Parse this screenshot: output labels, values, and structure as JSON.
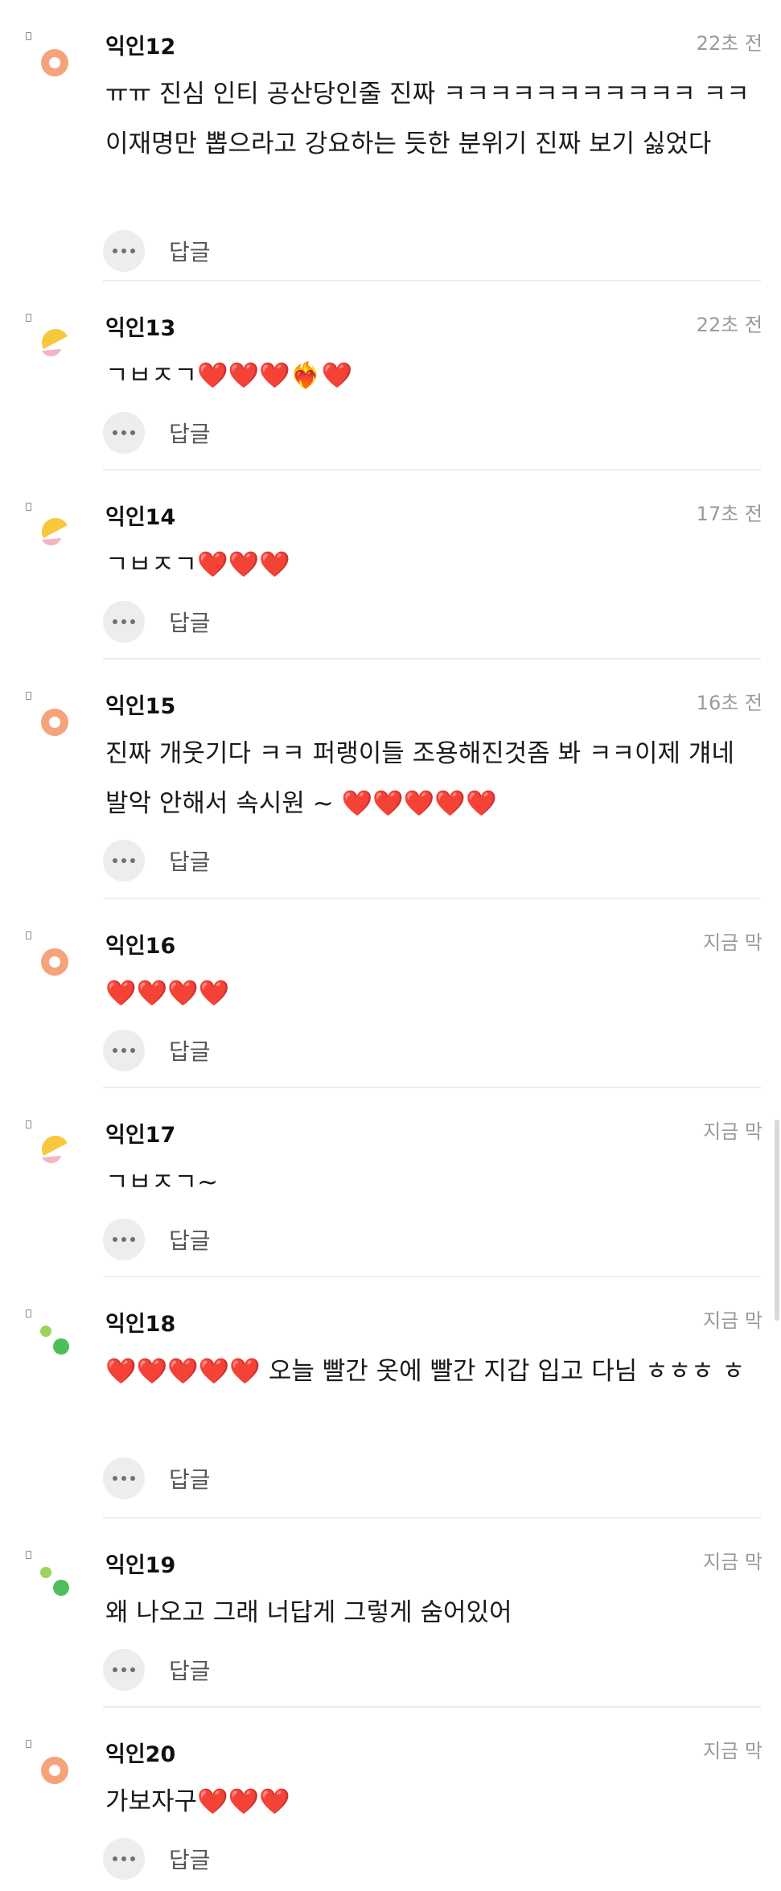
{
  "comments": [
    {
      "nick": "익인12",
      "time": "22초 전",
      "text": "ㅠㅠ 진심 인티 공산당인줄 진짜 ㅋㅋㅋㅋㅋㅋㅋㅋㅋㅋㅋ ㅋㅋ 이재명만 뽑으라고 강요하는 듯한 분위기 진짜 보기 싫었다",
      "avatar": "orange-ring-icon"
    },
    {
      "nick": "익인13",
      "time": "22초 전",
      "text": "ㄱㅂㅈㄱ❤️❤️❤️❤️‍🔥❤️",
      "avatar": "yellow-pink-moon-icon"
    },
    {
      "nick": "익인14",
      "time": "17초 전",
      "text": "ㄱㅂㅈㄱ❤️❤️❤️",
      "avatar": "yellow-pink-moon-icon"
    },
    {
      "nick": "익인15",
      "time": "16초 전",
      "text": "진짜 개웃기다 ㅋㅋ 퍼랭이들 조용해진것좀 봐 ㅋㅋ이제 걔네 발악 안해서 속시원 ~ ❤️❤️❤️❤️❤️",
      "avatar": "orange-ring-icon"
    },
    {
      "nick": "익인16",
      "time": "지금 막",
      "text": "❤️❤️❤️❤️",
      "avatar": "orange-ring-icon"
    },
    {
      "nick": "익인17",
      "time": "지금 막",
      "text": "ㄱㅂㅈㄱ~",
      "avatar": "yellow-pink-moon-icon"
    },
    {
      "nick": "익인18",
      "time": "지금 막",
      "text": "❤️❤️❤️❤️❤️ 오늘 빨간 옷에 빨간 지갑 입고 다님 ㅎㅎㅎ ㅎ",
      "avatar": "green-dots-icon"
    },
    {
      "nick": "익인19",
      "time": "지금 막",
      "text": "왜 나오고 그래 너답게 그렇게 숨어있어",
      "avatar": "green-dots-icon"
    },
    {
      "nick": "익인20",
      "time": "지금 막",
      "text": "가보자구❤️❤️❤️",
      "avatar": "orange-ring-icon"
    }
  ],
  "reply_label": "답글",
  "colors": {
    "orange": "#f5a37a",
    "yellow": "#f7c83c",
    "pink": "#f3b5c4",
    "green_dark": "#4cbf5b",
    "green_light": "#9ad45a"
  }
}
